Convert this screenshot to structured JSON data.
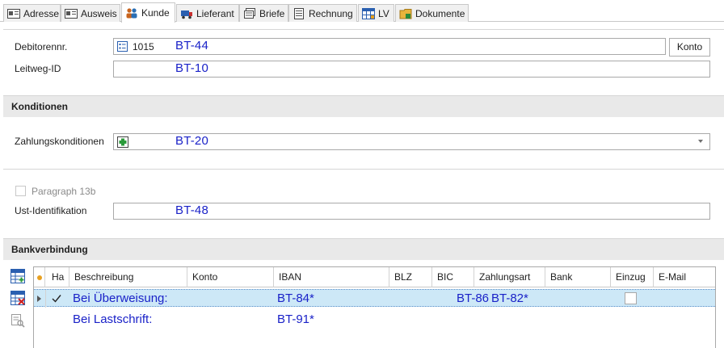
{
  "tabs": [
    {
      "label": "Adresse",
      "icon": "address-card-icon"
    },
    {
      "label": "Ausweis",
      "icon": "id-card-icon"
    },
    {
      "label": "Kunde",
      "icon": "customer-icon"
    },
    {
      "label": "Lieferant",
      "icon": "supplier-icon"
    },
    {
      "label": "Briefe",
      "icon": "letters-icon"
    },
    {
      "label": "Rechnung",
      "icon": "invoice-icon"
    },
    {
      "label": "LV",
      "icon": "service-list-icon"
    },
    {
      "label": "Dokumente",
      "icon": "documents-icon"
    }
  ],
  "active_tab": "Kunde",
  "customer": {
    "debitor_label": "Debitorennr.",
    "debitor_value": "1015",
    "debitor_tag": "BT-44",
    "konto_button": "Konto",
    "leitweg_label": "Leitweg-ID",
    "leitweg_tag": "BT-10"
  },
  "konditionen": {
    "header": "Konditionen",
    "zahlung_label": "Zahlungskonditionen",
    "zahlung_tag": "BT-20"
  },
  "tax": {
    "paragraph_label": "Paragraph 13b",
    "ust_label": "Ust-Identifikation",
    "ust_tag": "BT-48"
  },
  "bank": {
    "header": "Bankverbindung",
    "columns": [
      "Ha",
      "Beschreibung",
      "Konto",
      "IBAN",
      "BLZ",
      "BIC",
      "Zahlungsart",
      "Bank",
      "Einzug",
      "E-Mail"
    ],
    "rows": [
      {
        "beschreibung": "Bei Überweisung:",
        "iban": "BT-84*",
        "bic": "BT-86",
        "zahlungsart": "BT-82*",
        "selected": true,
        "checked": true
      },
      {
        "beschreibung": "Bei Lastschrift:",
        "iban": "BT-91*",
        "bic": "",
        "zahlungsart": "",
        "selected": false,
        "checked": false
      }
    ]
  },
  "colors": {
    "tag_blue": "#1a22c8",
    "selected_row": "#cde8f7",
    "section_bg": "#e9e9e9"
  }
}
